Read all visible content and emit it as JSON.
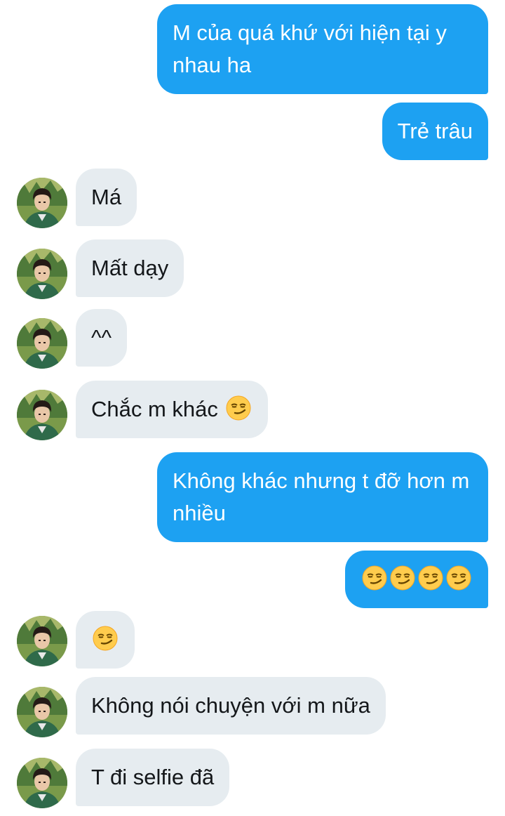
{
  "messages": [
    {
      "from": "me",
      "text": "M của quá khứ với hiện tại y nhau ha"
    },
    {
      "from": "me",
      "text": "Trẻ trâu"
    },
    {
      "from": "them",
      "text": "Má"
    },
    {
      "from": "them",
      "text": "Mất dạy"
    },
    {
      "from": "them",
      "text": "^^"
    },
    {
      "from": "them",
      "text": "Chắc m khác",
      "emoji": [
        "smirking-face"
      ]
    },
    {
      "from": "me",
      "text": "Không khác nhưng t đỡ hơn m nhiều"
    },
    {
      "from": "me",
      "text": "",
      "emoji": [
        "smirking-face",
        "smirking-face",
        "smirking-face",
        "smirking-face"
      ]
    },
    {
      "from": "them",
      "text": "",
      "emoji": [
        "smirking-face"
      ]
    },
    {
      "from": "them",
      "text": "Không nói chuyện với m nữa"
    },
    {
      "from": "them",
      "text": "T đi selfie đã"
    }
  ],
  "colors": {
    "outgoing_bubble": "#1da1f2",
    "incoming_bubble": "#e6ecf0",
    "outgoing_text": "#ffffff",
    "incoming_text": "#14171a"
  },
  "icons": {
    "avatar": "contact-avatar",
    "emoji": "smirking-face-icon"
  }
}
